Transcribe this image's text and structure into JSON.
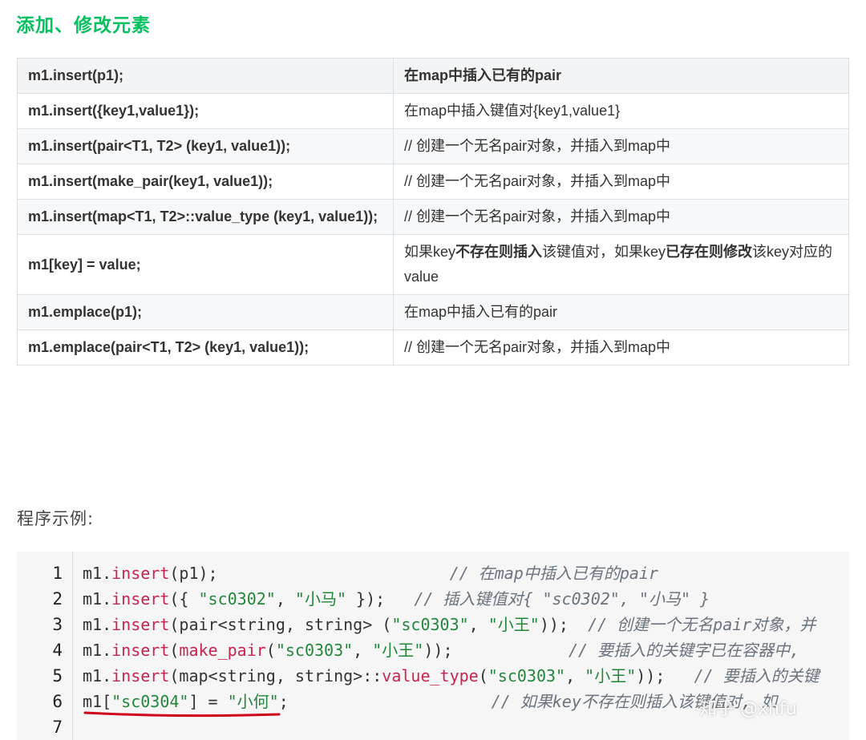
{
  "page": {
    "title": "添加、修改元素",
    "section_label": "程序示例:"
  },
  "table": {
    "rows": [
      {
        "code": "m1.insert(p1);",
        "desc": [
          "在map中插入已有的pair"
        ]
      },
      {
        "code": "m1.insert({key1,value1});",
        "desc": [
          "在map中插入键值对{key1,value1}"
        ]
      },
      {
        "code": "m1.insert(pair<T1, T2> (key1, value1));",
        "desc": [
          "// 创建一个无名pair对象，并插入到map中"
        ]
      },
      {
        "code": "m1.insert(make_pair(key1, value1));",
        "desc": [
          "// 创建一个无名pair对象，并插入到map中"
        ]
      },
      {
        "code": "m1.insert(map<T1, T2>::value_type (key1, value1));",
        "desc": [
          "// 创建一个无名pair对象，并插入到map中"
        ]
      },
      {
        "code": "m1[key] = value;",
        "desc": [
          "如果key",
          "不存在则插入",
          "该键值对，如果key",
          "已存在则修改",
          "该key对应的value"
        ]
      },
      {
        "code": "m1.emplace(p1);",
        "desc": [
          "在map中插入已有的pair"
        ]
      },
      {
        "code": "m1.emplace(pair<T1, T2> (key1, value1));",
        "desc": [
          "// 创建一个无名pair对象，并插入到map中"
        ]
      }
    ]
  },
  "code": {
    "line_numbers": [
      "1",
      "2",
      "3",
      "4",
      "5",
      "6",
      "7"
    ],
    "lines": [
      [
        "m1.",
        "insert",
        "(p1);                        ",
        "// 在map中插入已有的pair"
      ],
      [
        "m1.",
        "insert",
        "({ ",
        "\"sc0302\"",
        ", ",
        "\"小马\"",
        " });   ",
        "// 插入键值对{ \"sc0302\", \"小马\" }"
      ],
      [
        "m1.",
        "insert",
        "(pair<string, string> (",
        "\"sc0303\"",
        ", ",
        "\"小王\"",
        "));  ",
        "// 创建一个无名pair对象，并"
      ],
      [
        "m1.",
        "insert",
        "(",
        "make_pair",
        "(",
        "\"sc0303\"",
        ", ",
        "\"小王\"",
        "));            ",
        "// 要插入的关键字已在容器中,"
      ],
      [
        "m1.",
        "insert",
        "(map<string, string>::",
        "value_type",
        "(",
        "\"sc0303\"",
        ", ",
        "\"小王\"",
        "));   ",
        "// 要插入的关键"
      ],
      [
        "m1[",
        "\"sc0304\"",
        "] = ",
        "\"小何\"",
        ";                     ",
        "// 如果key不存在则插入该键值对, 如"
      ]
    ]
  },
  "colors": {
    "title": "#07c160",
    "keyword": "#c7254e",
    "string": "#22863a",
    "comment": "#6a737d",
    "underline": "#d0021b"
  },
  "watermark": {
    "text": "知乎 @xhfu"
  }
}
